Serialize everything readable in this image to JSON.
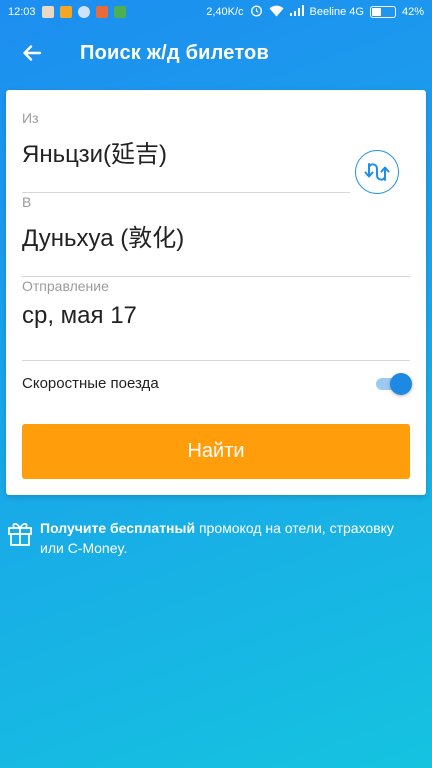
{
  "status_bar": {
    "time": "12:03",
    "network_speed": "2,40K/c",
    "carrier": "Beeline 4G",
    "battery_percent_text": "42%",
    "battery_level": 0.42
  },
  "app_bar": {
    "title": "Поиск ж/д билетов"
  },
  "form": {
    "from": {
      "label": "Из",
      "value": "Яньцзи(延吉)"
    },
    "to": {
      "label": "В",
      "value": "Дуньхуа (敦化)"
    },
    "departure": {
      "label": "Отправление",
      "value": "ср, мая 17"
    },
    "speed_trains": {
      "label": "Скоростные поезда",
      "enabled": true
    },
    "find_button": "Найти"
  },
  "promo": {
    "bold_text": "Получите бесплатный",
    "rest_text": " промокод на отели, страховку или C-Money."
  },
  "colors": {
    "accent_blue": "#1e88e5",
    "button_orange": "#ff9d0a",
    "background_start": "#1d8ef0",
    "background_end": "#15c3df"
  },
  "icons": {
    "back": "arrow-left-icon",
    "swap": "swap-icon",
    "gift": "gift-icon",
    "alarm": "alarm-icon",
    "wifi": "wifi-icon",
    "signal": "signal-icon",
    "battery": "battery-icon"
  }
}
